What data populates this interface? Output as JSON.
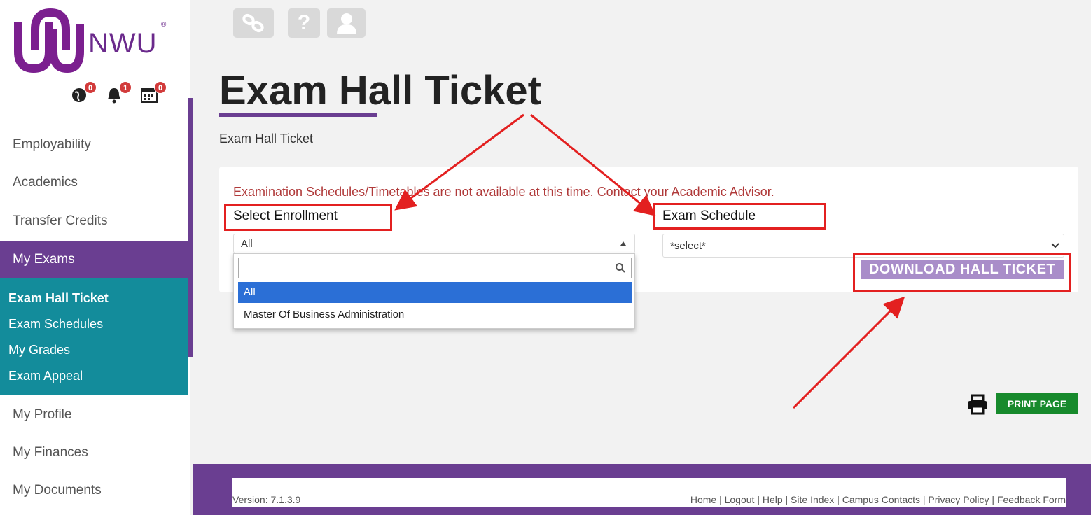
{
  "brand": {
    "name": "NWU",
    "reg": "®",
    "purple": "#6a3e91",
    "teal": "#138c9b"
  },
  "badges": [
    {
      "icon": "globe-icon",
      "count": "0"
    },
    {
      "icon": "bell-icon",
      "count": "1"
    },
    {
      "icon": "calendar-icon",
      "count": "0"
    }
  ],
  "sidebar": {
    "items": [
      {
        "label": "Employability"
      },
      {
        "label": "Academics"
      },
      {
        "label": "Transfer Credits"
      },
      {
        "label": "My Exams"
      }
    ],
    "sub": [
      {
        "label": "Exam Hall Ticket"
      },
      {
        "label": "Exam Schedules"
      },
      {
        "label": "My Grades"
      },
      {
        "label": "Exam Appeal"
      }
    ],
    "bottom": [
      {
        "label": "My Profile"
      },
      {
        "label": "My Finances"
      },
      {
        "label": "My Documents"
      }
    ]
  },
  "toolbar": {
    "icons": [
      "link-icon",
      "help-icon",
      "user-icon"
    ],
    "help_glyph": "?"
  },
  "page": {
    "title": "Exam Hall Ticket",
    "breadcrumb": "Exam Hall Ticket",
    "error": "Examination Schedules/Timetables are not available at this time. Contact your Academic Advisor."
  },
  "form": {
    "enrollment_label": "Select Enrollment",
    "enrollment_value": "All",
    "enrollment_options": [
      "All",
      "Master Of Business Administration"
    ],
    "schedule_label": "Exam Schedule",
    "schedule_value": "*select*",
    "download_label": "DOWNLOAD HALL TICKET"
  },
  "print_label": "PRINT PAGE",
  "footer": {
    "version": "Version: 7.1.3.9",
    "links": "Home | Logout | Help | Site Index | Campus Contacts | Privacy Policy | Feedback Form"
  }
}
